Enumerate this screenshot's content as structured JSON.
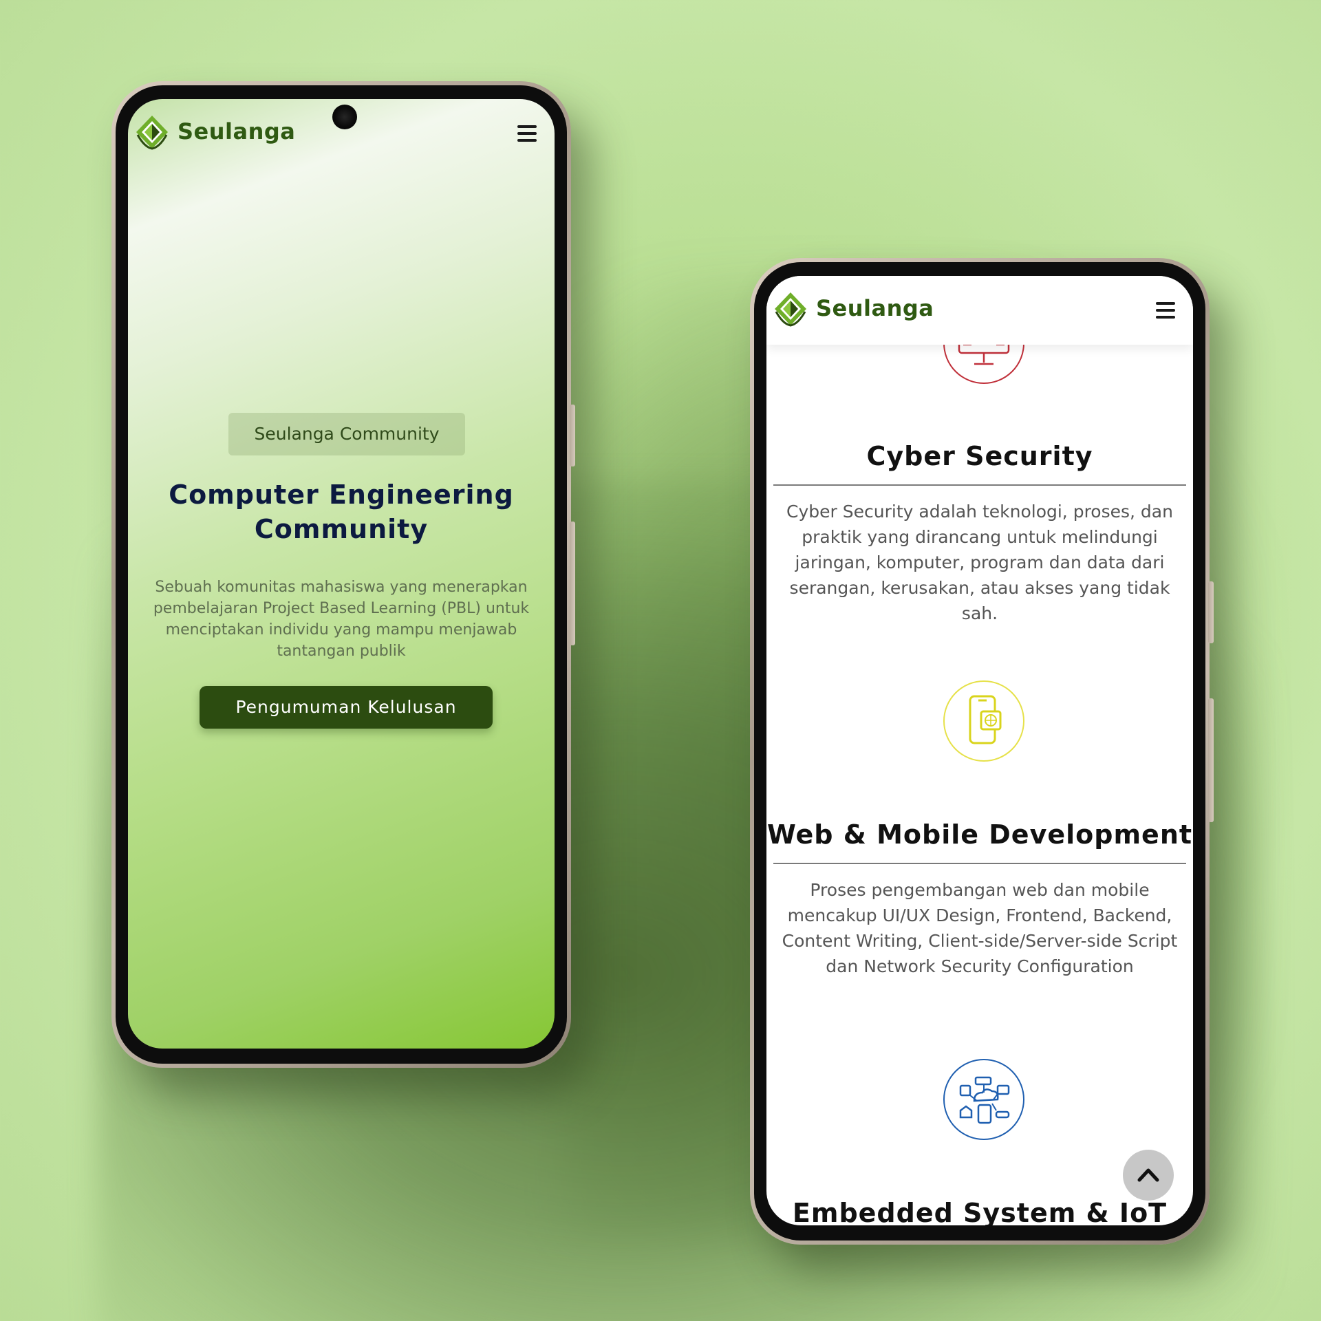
{
  "brand": {
    "name": "Seulanga",
    "primary_color": "#2c4c10",
    "accent_color": "#6fae2a"
  },
  "hero": {
    "badge": "Seulanga Community",
    "title": "Computer Engineering Community",
    "description": "Sebuah komunitas mahasiswa yang menerapkan pembelajaran Project Based Learning (PBL) untuk menciptakan individu yang mampu menjawab tantangan publik",
    "button_label": "Pengumuman Kelulusan"
  },
  "services": [
    {
      "title": "Cyber Security",
      "description": "Cyber Security adalah teknologi, proses, dan praktik yang dirancang untuk melindungi jaringan, komputer, program dan data dari serangan, kerusakan, atau akses yang tidak sah.",
      "icon": "shield-monitor-icon",
      "color": "#c0303a"
    },
    {
      "title": "Web & Mobile Development",
      "description": "Proses pengembangan web dan mobile mencakup UI/UX Design, Frontend, Backend, Content Writing, Client-side/Server-side Script dan Network Security Configuration",
      "icon": "mobile-web-icon",
      "color": "#d9d41c"
    },
    {
      "title": "Embedded System & IoT",
      "icon": "iot-network-icon",
      "color": "#1f5fb0"
    }
  ],
  "icons": {
    "menu": "hamburger-menu-icon",
    "scroll_top": "chevron-up-icon"
  }
}
